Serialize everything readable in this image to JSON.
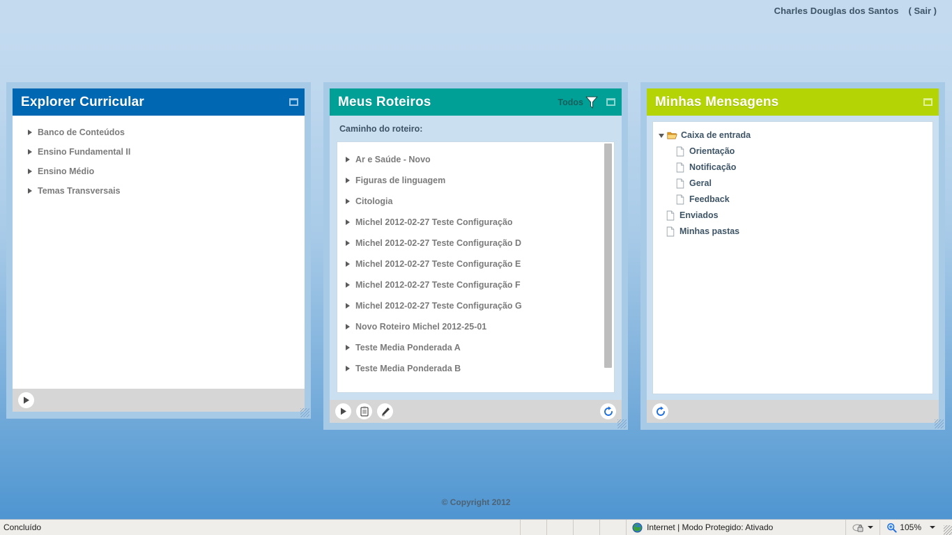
{
  "topbar": {
    "user_name": "Charles Douglas dos Santos",
    "logout_label": "( Sair )"
  },
  "panels": {
    "explorer": {
      "title": "Explorer Curricular",
      "header_color": "#0068b3",
      "restore_icon": "restore-icon",
      "items": [
        {
          "label": "Banco de Conteúdos"
        },
        {
          "label": "Ensino Fundamental II"
        },
        {
          "label": "Ensino Médio"
        },
        {
          "label": "Temas Transversais"
        }
      ],
      "footer": {
        "buttons": [
          {
            "icon": "play-icon",
            "name": "play-button"
          }
        ]
      }
    },
    "roteiros": {
      "title": "Meus Roteiros",
      "header_color": "#00a096",
      "filter_label": "Todos",
      "filter_icon": "funnel-icon",
      "restore_icon": "restore-icon",
      "path_label": "Caminho do roteiro:",
      "items": [
        {
          "label": "Ar e Saúde - Novo"
        },
        {
          "label": "Figuras de linguagem"
        },
        {
          "label": "Citologia"
        },
        {
          "label": "Michel 2012-02-27 Teste Configuração"
        },
        {
          "label": "Michel 2012-02-27 Teste Configuração D"
        },
        {
          "label": "Michel 2012-02-27 Teste Configuração E"
        },
        {
          "label": "Michel 2012-02-27 Teste Configuração F"
        },
        {
          "label": "Michel 2012-02-27 Teste Configuração G"
        },
        {
          "label": "Novo Roteiro Michel 2012-25-01"
        },
        {
          "label": "Teste Media Ponderada A"
        },
        {
          "label": "Teste Media Ponderada B"
        }
      ],
      "footer": {
        "buttons": [
          {
            "icon": "play-icon",
            "name": "play-button"
          },
          {
            "icon": "clipboard-icon",
            "name": "clipboard-button"
          },
          {
            "icon": "pencil-icon",
            "name": "edit-button"
          }
        ],
        "refresh_icon": "refresh-icon"
      }
    },
    "mensagens": {
      "title": "Minhas Mensagens",
      "header_color": "#b4d406",
      "restore_icon": "restore-icon",
      "tree": [
        {
          "label": "Caixa de entrada",
          "level": 0,
          "icon": "folder-open-icon",
          "expanded": true
        },
        {
          "label": "Orientação",
          "level": 1,
          "icon": "document-icon"
        },
        {
          "label": "Notificação",
          "level": 1,
          "icon": "document-icon"
        },
        {
          "label": "Geral",
          "level": 1,
          "icon": "document-icon"
        },
        {
          "label": "Feedback",
          "level": 1,
          "icon": "document-icon"
        },
        {
          "label": "Enviados",
          "level": 0,
          "icon": "document-icon"
        },
        {
          "label": "Minhas pastas",
          "level": 0,
          "icon": "document-icon"
        }
      ],
      "footer": {
        "refresh_icon": "refresh-icon"
      }
    }
  },
  "footer": {
    "copyright": "© Copyright 2012"
  },
  "statusbar": {
    "status_text": "Concluído",
    "zone_icon": "globe-icon",
    "zone_text": "Internet | Modo Protegido: Ativado",
    "privacy_icon": "privacy-lock-icon",
    "zoom_icon": "zoom-magnifier-icon",
    "zoom_level": "105%"
  }
}
